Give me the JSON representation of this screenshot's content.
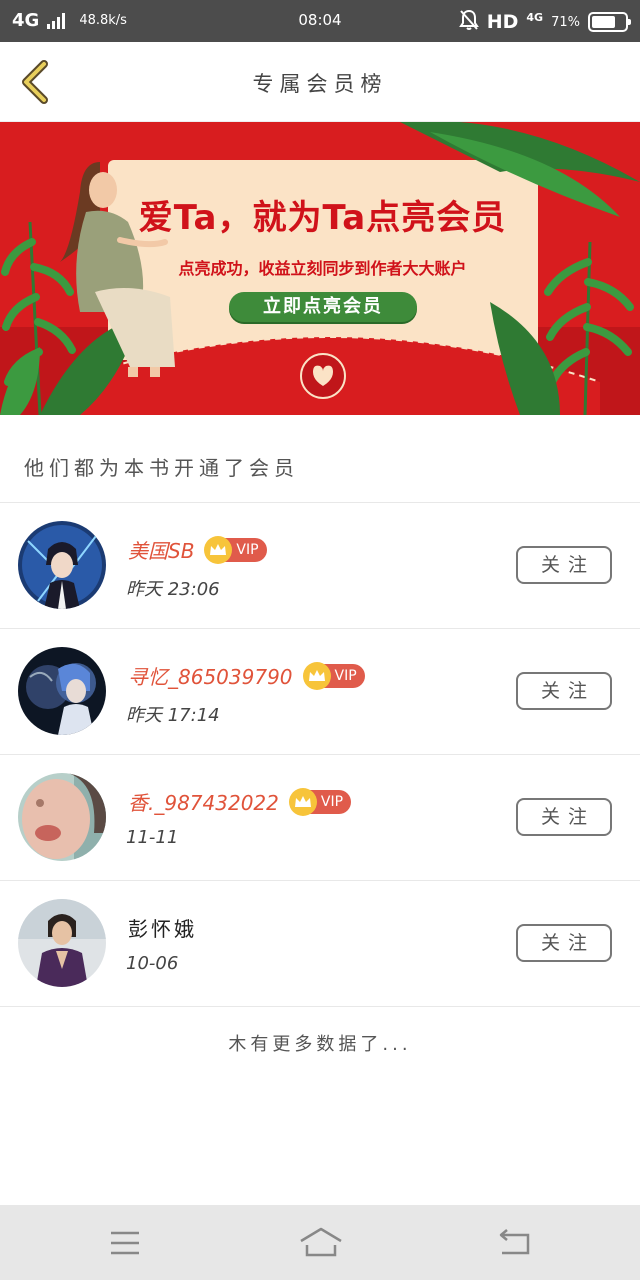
{
  "status_bar": {
    "network": "4G",
    "speed": "48.8k/s",
    "time": "08:04",
    "hd": "HD",
    "network_right": "4G",
    "battery": "71%",
    "battery_level": 0.71
  },
  "header": {
    "title": "专属会员榜"
  },
  "banner": {
    "title": "爱Ta，就为Ta点亮会员",
    "subtitle": "点亮成功，收益立刻同步到作者大大账户",
    "button": "立即点亮会员"
  },
  "section": {
    "title": "他们都为本书开通了会员"
  },
  "members": [
    {
      "name": "美国SB",
      "vip": "VIP",
      "time": "昨天 23:06",
      "follow": "关注"
    },
    {
      "name": "寻忆_865039790",
      "vip": "VIP",
      "time": "昨天 17:14",
      "follow": "关注"
    },
    {
      "name": "香._987432022",
      "vip": "VIP",
      "time": "11-11",
      "follow": "关注"
    },
    {
      "name": "彭怀娥",
      "vip": "",
      "time": "10-06",
      "follow": "关注"
    }
  ],
  "footer": {
    "no_more": "木有更多数据了..."
  },
  "colors": {
    "banner_red": "#d81d1f",
    "name_orange": "#e0533a",
    "vip_red": "#e05b4b",
    "button_green": "#3e8b3a",
    "status_bar": "#4c4c4c"
  }
}
